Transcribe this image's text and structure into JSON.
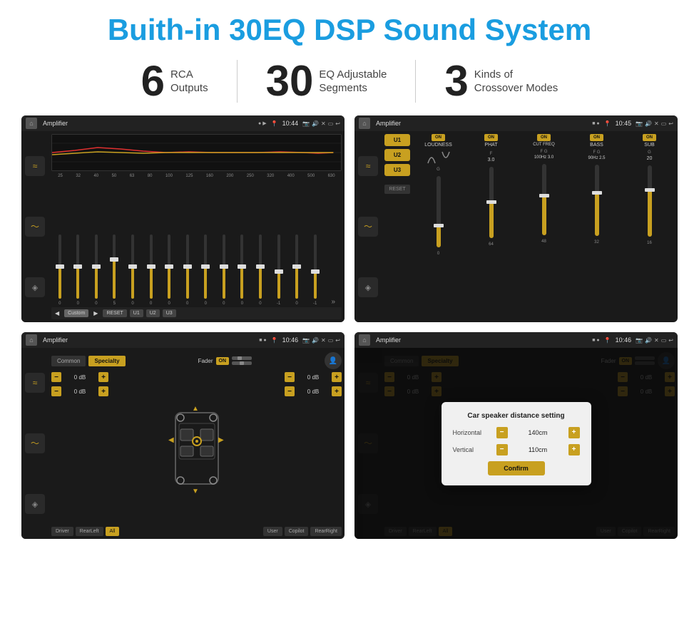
{
  "header": {
    "title": "Buith-in 30EQ DSP Sound System"
  },
  "stats": [
    {
      "number": "6",
      "line1": "RCA",
      "line2": "Outputs"
    },
    {
      "number": "30",
      "line1": "EQ Adjustable",
      "line2": "Segments"
    },
    {
      "number": "3",
      "line1": "Kinds of",
      "line2": "Crossover Modes"
    }
  ],
  "screens": [
    {
      "id": "screen1",
      "status_title": "Amplifier",
      "time": "10:44",
      "eq_labels": [
        "25",
        "32",
        "40",
        "50",
        "63",
        "80",
        "100",
        "125",
        "160",
        "200",
        "250",
        "320",
        "400",
        "500",
        "630"
      ],
      "eq_values": [
        "0",
        "0",
        "0",
        "5",
        "0",
        "0",
        "0",
        "0",
        "0",
        "0",
        "0",
        "0",
        "-1",
        "0",
        "-1"
      ],
      "eq_sliders": [
        50,
        50,
        50,
        65,
        50,
        50,
        50,
        50,
        50,
        50,
        50,
        50,
        40,
        50,
        40
      ],
      "bottom_btns": [
        "Custom",
        "RESET",
        "U1",
        "U2",
        "U3"
      ]
    },
    {
      "id": "screen2",
      "status_title": "Amplifier",
      "time": "10:45",
      "presets": [
        "U1",
        "U2",
        "U3"
      ],
      "channels": [
        "LOUDNESS",
        "PHAT",
        "CUT FREQ",
        "BASS",
        "SUB"
      ],
      "channel_on": [
        true,
        true,
        true,
        true,
        true
      ],
      "reset_btn": "RESET"
    },
    {
      "id": "screen3",
      "status_title": "Amplifier",
      "time": "10:46",
      "tabs": [
        "Common",
        "Specialty"
      ],
      "fader_label": "Fader",
      "fader_on": "ON",
      "db_values": [
        "0 dB",
        "0 dB",
        "0 dB",
        "0 dB"
      ],
      "zone_btns": [
        "Driver",
        "RearLeft",
        "All",
        "User",
        "Copilot",
        "RearRight"
      ]
    },
    {
      "id": "screen4",
      "status_title": "Amplifier",
      "time": "10:46",
      "dialog": {
        "title": "Car speaker distance setting",
        "horizontal_label": "Horizontal",
        "horizontal_value": "140cm",
        "vertical_label": "Vertical",
        "vertical_value": "110cm",
        "confirm_btn": "Confirm"
      }
    }
  ],
  "icons": {
    "home": "⌂",
    "menu": "≡",
    "dot": "●",
    "pin": "📍",
    "camera": "📷",
    "volume": "🔊",
    "close": "✕",
    "minimize": "▭",
    "back": "↩",
    "eq_icon": "≈",
    "wave_icon": "〜",
    "speaker_icon": "◈",
    "chevron_left": "◀",
    "chevron_right": "▶",
    "chevron_double_right": "»",
    "person": "👤"
  }
}
